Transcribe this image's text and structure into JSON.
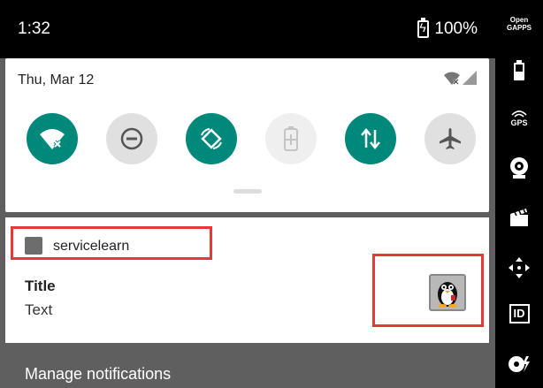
{
  "status_bar": {
    "time": "1:32",
    "battery": "100%"
  },
  "quick_settings": {
    "date": "Thu, Mar 12",
    "tiles": [
      {
        "name": "wifi",
        "state": "on"
      },
      {
        "name": "do-not-disturb",
        "state": "off"
      },
      {
        "name": "auto-rotate",
        "state": "on"
      },
      {
        "name": "battery-saver",
        "state": "disabled"
      },
      {
        "name": "mobile-data",
        "state": "on"
      },
      {
        "name": "airplane-mode",
        "state": "off"
      }
    ]
  },
  "notification": {
    "app_name": "servicelearn",
    "title": "Title",
    "text": "Text"
  },
  "footer": {
    "manage_label": "Manage notifications"
  },
  "emulator_sidebar": {
    "opengapps_label": "Open GAPPS",
    "gps_label": "GPS",
    "id_label": "ID"
  },
  "colors": {
    "accent": "#00897b",
    "highlight_box": "#e53935"
  }
}
